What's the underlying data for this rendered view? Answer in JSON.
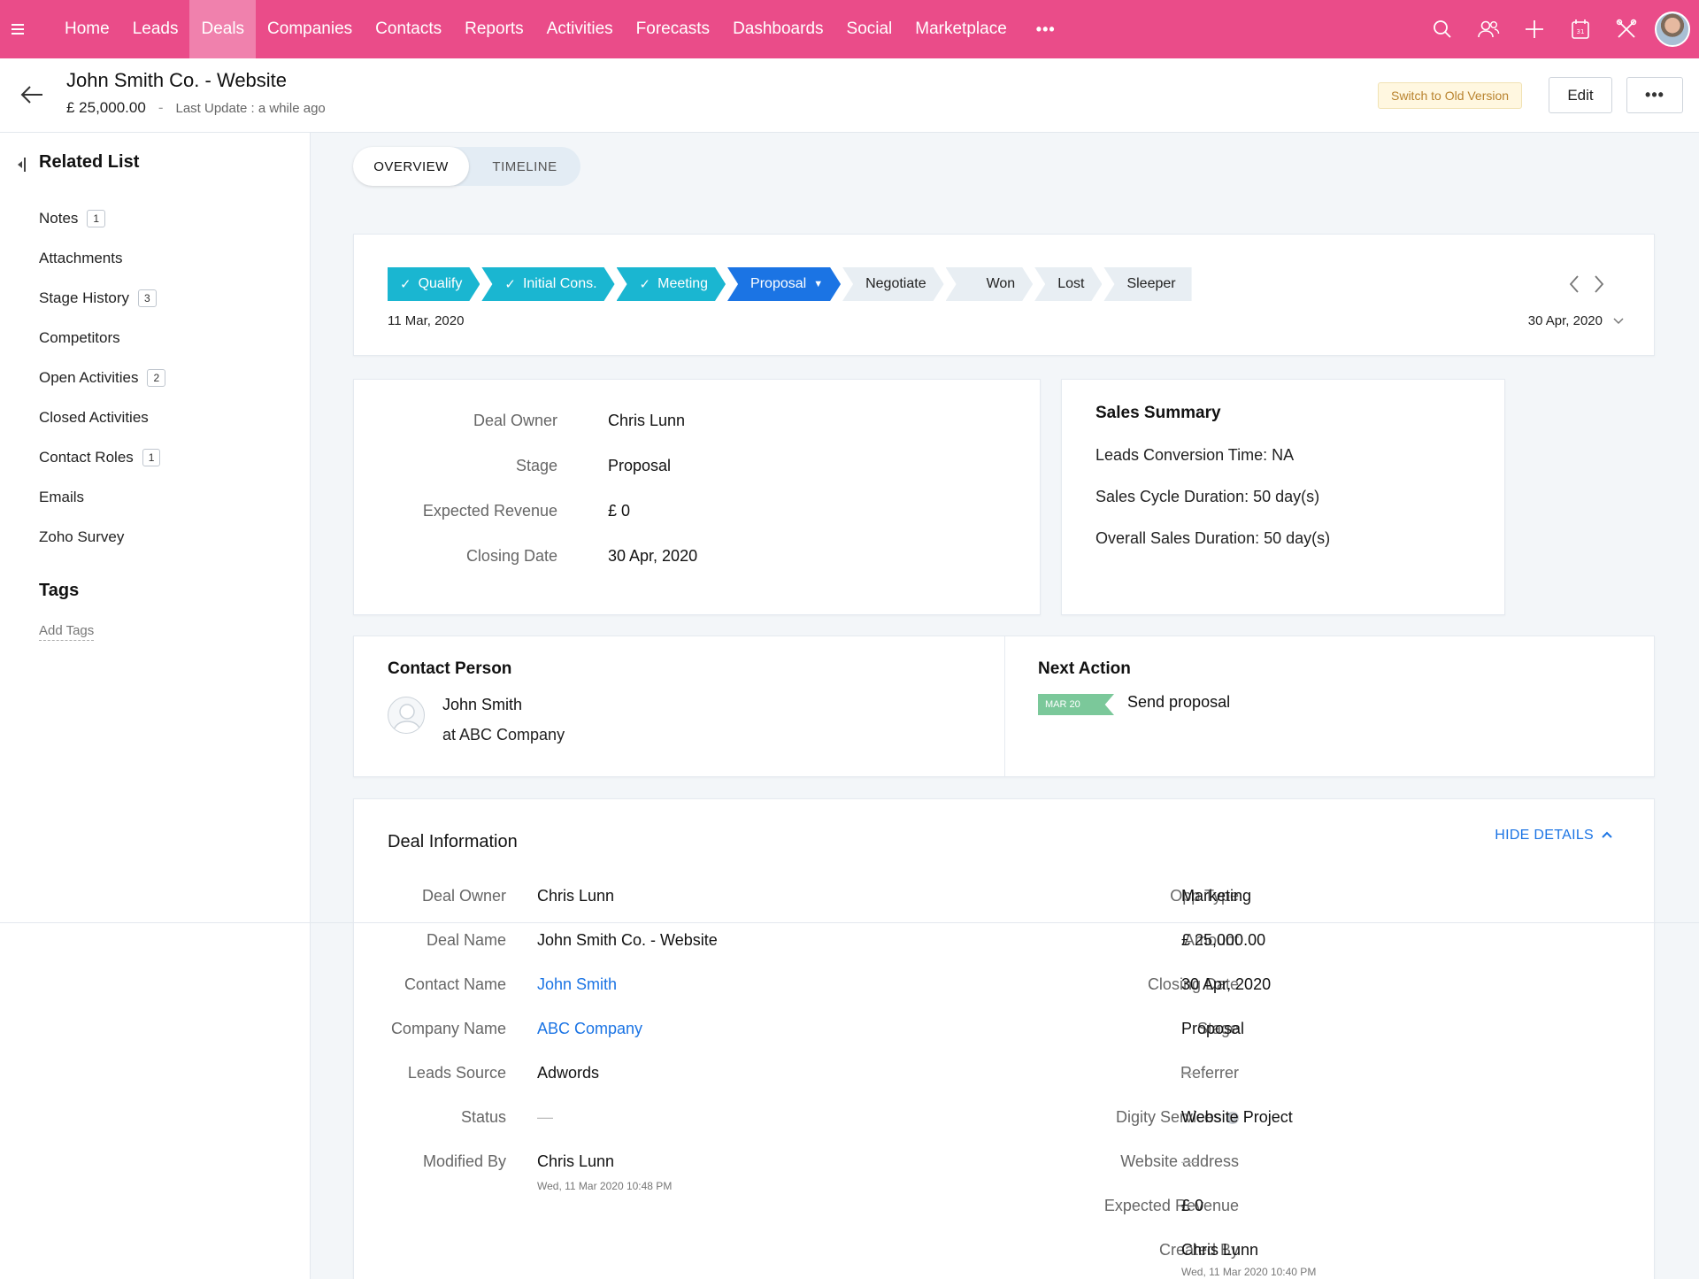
{
  "nav": {
    "items": [
      "Home",
      "Leads",
      "Deals",
      "Companies",
      "Contacts",
      "Reports",
      "Activities",
      "Forecasts",
      "Dashboards",
      "Social",
      "Marketplace"
    ],
    "active": "Deals",
    "more": "•••",
    "icons": [
      "search-icon",
      "contacts-icon",
      "plus-icon",
      "calendar-icon",
      "tools-icon",
      "user-avatar"
    ],
    "accent": "#ea4c89"
  },
  "header": {
    "title": "John Smith Co. - Website",
    "amount": "£ 25,000.00",
    "separator": "-",
    "last_update": "Last Update : a while ago",
    "switch_old": "Switch to Old Version",
    "edit": "Edit",
    "more": "•••"
  },
  "sidebar": {
    "heading": "Related List",
    "items": [
      {
        "label": "Notes",
        "badge": "1"
      },
      {
        "label": "Attachments",
        "badge": ""
      },
      {
        "label": "Stage History",
        "badge": "3"
      },
      {
        "label": "Competitors",
        "badge": ""
      },
      {
        "label": "Open Activities",
        "badge": "2"
      },
      {
        "label": "Closed Activities",
        "badge": ""
      },
      {
        "label": "Contact Roles",
        "badge": "1"
      },
      {
        "label": "Emails",
        "badge": ""
      },
      {
        "label": "Zoho Survey",
        "badge": ""
      }
    ],
    "tags_heading": "Tags",
    "add_tags": "Add Tags"
  },
  "tabs": {
    "overview": "OVERVIEW",
    "timeline": "TIMELINE"
  },
  "stages": {
    "items": [
      {
        "label": "Qualify",
        "state": "done"
      },
      {
        "label": "Initial Cons.",
        "state": "done"
      },
      {
        "label": "Meeting",
        "state": "done"
      },
      {
        "label": "Proposal",
        "state": "current"
      },
      {
        "label": "Negotiate",
        "state": "todo"
      },
      {
        "label": "Won",
        "state": "todo"
      },
      {
        "label": "Lost",
        "state": "todo"
      },
      {
        "label": "Sleeper",
        "state": "todo"
      }
    ],
    "start_date": "11 Mar, 2020",
    "end_date": "30 Apr, 2020"
  },
  "summary": {
    "rows": [
      {
        "label": "Deal Owner",
        "value": "Chris Lunn"
      },
      {
        "label": "Stage",
        "value": "Proposal"
      },
      {
        "label": "Expected Revenue",
        "value": "£ 0"
      },
      {
        "label": "Closing Date",
        "value": "30 Apr, 2020"
      }
    ]
  },
  "sales_summary": {
    "title": "Sales Summary",
    "lines": [
      "Leads Conversion Time: NA",
      "Sales Cycle Duration: 50 day(s)",
      "Overall Sales Duration: 50 day(s)"
    ]
  },
  "contact": {
    "title": "Contact Person",
    "name": "John Smith",
    "company": "at ABC Company"
  },
  "next_action": {
    "title": "Next Action",
    "date": "MAR 20",
    "text": "Send proposal"
  },
  "deal_info": {
    "title": "Deal Information",
    "hide": "HIDE DETAILS",
    "left": [
      {
        "label": "Deal Owner",
        "value": "Chris Lunn",
        "kind": "text"
      },
      {
        "label": "Deal Name",
        "value": "John Smith Co. - Website",
        "kind": "text"
      },
      {
        "label": "Contact Name",
        "value": "John Smith",
        "kind": "link"
      },
      {
        "label": "Company Name",
        "value": "ABC Company",
        "kind": "link"
      },
      {
        "label": "Leads Source",
        "value": "Adwords",
        "kind": "text"
      },
      {
        "label": "Status",
        "value": "—",
        "kind": "dash"
      },
      {
        "label": "Modified By",
        "value": "Chris Lunn",
        "kind": "text",
        "sub": "Wed, 11 Mar 2020 10:48 PM"
      }
    ],
    "right": [
      {
        "label": "Opp Type",
        "value": "Marketing",
        "kind": "text"
      },
      {
        "label": "Amount",
        "value": "£ 25,000.00",
        "kind": "text"
      },
      {
        "label": "Closing Date",
        "value": "30 Apr, 2020",
        "kind": "text"
      },
      {
        "label": "Stage",
        "value": "Proposal",
        "kind": "text"
      },
      {
        "label": "Referrer",
        "value": "—",
        "kind": "dash"
      },
      {
        "label": "Digity Services",
        "value": "Website Project",
        "kind": "text",
        "info": "i"
      },
      {
        "label": "Website address",
        "value": "—",
        "kind": "dash"
      },
      {
        "label": "Expected Revenue",
        "value": "£ 0",
        "kind": "text"
      },
      {
        "label": "Created By",
        "value": "Chris Lunn",
        "kind": "text",
        "sub": "Wed, 11 Mar 2020 10:40 PM"
      }
    ]
  }
}
